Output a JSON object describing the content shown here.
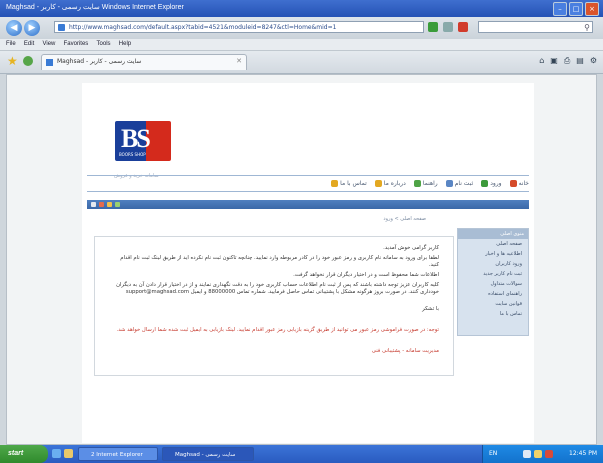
{
  "window": {
    "title": "Maghsad - سایت رسمی - کاربر Windows Internet Explorer"
  },
  "address_bar": {
    "url": "http://www.maghsad.com/default.aspx?tabid=4521&moduleid=8247&ctl=Home&mid=1",
    "search_placeholder": ""
  },
  "menu": {
    "items": [
      "File",
      "Edit",
      "View",
      "Favorites",
      "Tools",
      "Help"
    ]
  },
  "tab": {
    "label": "Maghsad - سایت رسمی - کاربر"
  },
  "command_icons": [
    "home-icon",
    "feeds-icon",
    "print-icon",
    "page-icon",
    "tools-icon"
  ],
  "site": {
    "logo_letters": "BS",
    "logo_sub": "BOORS SHOP",
    "slogan": "سامانه خرید و فروش",
    "nav": [
      "خانه",
      "ورود",
      "ثبت نام",
      "راهنما",
      "درباره ما",
      "تماس با ما"
    ],
    "breadcrumb": "صفحه اصلی > ورود",
    "sidebar_title": "منوی اصلی",
    "sidebar_items": [
      "صفحه اصلی",
      "اطلاعیه ها و اخبار",
      "ورود کاربران",
      "ثبت نام کاربر جدید",
      "سوالات متداول",
      "راهنمای استفاده",
      "قوانین سایت",
      "تماس با ما"
    ],
    "paragraphs": [
      "کاربر گرامی خوش آمدید.",
      "لطفا برای ورود به سامانه نام کاربری و رمز عبور خود را در کادر مربوطه وارد نمایید. چنانچه تاکنون ثبت نام نکرده اید از طریق لینک ثبت نام اقدام کنید.",
      "اطلاعات شما محفوظ است و در اختیار دیگران قرار نخواهد گرفت.",
      "کلیه کاربران عزیز توجه داشته باشند که پس از ثبت نام اطلاعات حساب کاربری خود را به دقت نگهداری نمایند و از در اختیار قرار دادن آن به دیگران خودداری کنند. در صورت بروز هرگونه مشکل با پشتیبانی تماس حاصل فرمایید. شماره تماس 88000000 و ایمیل support@maghsad.com",
      "با تشکر",
      "توجه: در صورت فراموشی رمز عبور می توانید از طریق گزینه بازیابی رمز عبور اقدام نمایید. لینک بازیابی به ایمیل ثبت شده شما ارسال خواهد شد.",
      "مدیریت سامانه - پشتیبانی فنی"
    ]
  },
  "taskbar": {
    "start_label": "start",
    "tasks": [
      "2 Internet Explorer",
      "Maghsad - سایت رسمی"
    ],
    "language": "EN",
    "clock": "12:45 PM"
  },
  "colors": {
    "xp_blue": "#2552b5",
    "logo_blue": "#1a3f9a",
    "logo_red": "#d42a1c",
    "notice_red": "#c63a2e"
  }
}
